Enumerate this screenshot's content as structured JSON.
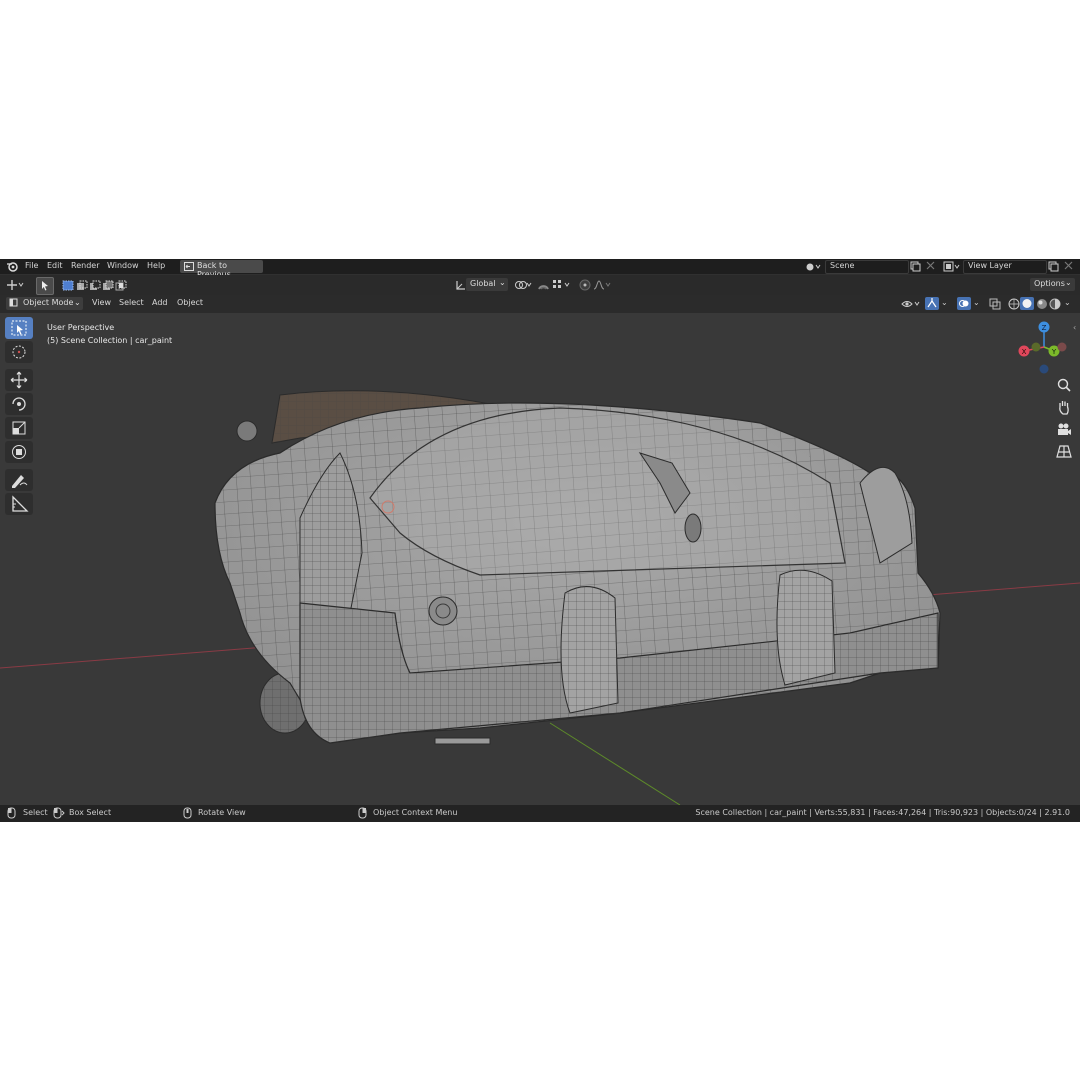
{
  "menubar": {
    "items": [
      "File",
      "Edit",
      "Render",
      "Window",
      "Help"
    ],
    "back_button": "Back to Previous",
    "scene": "Scene",
    "view_layer": "View Layer"
  },
  "toolbar_row": {
    "orientation": "Global",
    "options": "Options"
  },
  "header": {
    "mode": "Object Mode",
    "menus": [
      "View",
      "Select",
      "Add",
      "Object"
    ]
  },
  "viewport": {
    "perspective": "User Perspective",
    "collection": "(5) Scene Collection | car_paint",
    "gizmo": {
      "z": "Z",
      "y": "Y",
      "x": "X"
    }
  },
  "statusbar": {
    "select": "Select",
    "box_select": "Box Select",
    "rotate_view": "Rotate View",
    "context_menu": "Object Context Menu",
    "stats": "Scene Collection | car_paint | Verts:55,831 | Faces:47,264 | Tris:90,923 | Objects:0/24 | 2.91.0"
  },
  "colors": {
    "accent": "#5680c2",
    "axis_x": "#e0475b",
    "axis_y": "#7cba2a",
    "axis_z": "#3d8fe0"
  }
}
